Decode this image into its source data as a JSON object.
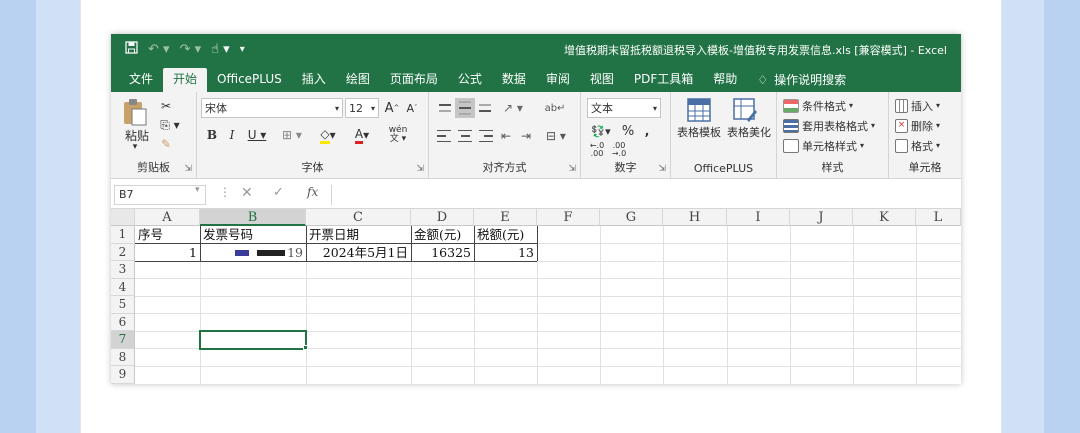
{
  "window": {
    "title": "增值税期末留抵税额退税导入模板-增值税专用发票信息.xls  [兼容模式]  -  Excel"
  },
  "qat": {
    "icons": [
      "save-icon",
      "undo-icon",
      "redo-icon",
      "touch-mode-icon",
      "customize-icon"
    ]
  },
  "tabs": [
    {
      "label": "文件"
    },
    {
      "label": "开始",
      "active": true
    },
    {
      "label": "OfficePLUS"
    },
    {
      "label": "插入"
    },
    {
      "label": "绘图"
    },
    {
      "label": "页面布局"
    },
    {
      "label": "公式"
    },
    {
      "label": "数据"
    },
    {
      "label": "审阅"
    },
    {
      "label": "视图"
    },
    {
      "label": "PDF工具箱"
    },
    {
      "label": "帮助"
    },
    {
      "label": "操作说明搜索"
    }
  ],
  "ribbon": {
    "clipboard": {
      "label": "剪贴板",
      "paste": "粘贴"
    },
    "font": {
      "label": "字体",
      "name": "宋体",
      "size": "12",
      "wen": "wén"
    },
    "alignment": {
      "label": "对齐方式"
    },
    "number": {
      "label": "数字",
      "format": "文本"
    },
    "officeplus": {
      "label": "OfficePLUS",
      "table_template": "表格模板",
      "table_beautify": "表格美化"
    },
    "styles": {
      "label": "样式",
      "conditional": "条件格式",
      "table_format": "套用表格格式",
      "cell_style": "单元格样式"
    },
    "cells": {
      "label": "单元格",
      "insert": "插入",
      "delete": "删除",
      "format": "格式"
    }
  },
  "formula_bar": {
    "name_box": "B7",
    "fx": "fx",
    "formula": ""
  },
  "sheet": {
    "columns": [
      "A",
      "B",
      "C",
      "D",
      "E",
      "F",
      "G",
      "H",
      "I",
      "J",
      "K",
      "L"
    ],
    "rows": [
      "1",
      "2",
      "3",
      "4",
      "5",
      "6",
      "7",
      "8",
      "9"
    ],
    "header_row": [
      "序号",
      "发票号码",
      "开票日期",
      "金额(元)",
      "税额(元)"
    ],
    "data_row": [
      "1",
      "19",
      "2024年5月1日",
      "16325",
      "13"
    ],
    "selected_cell": "B7",
    "accent": "#217346"
  }
}
